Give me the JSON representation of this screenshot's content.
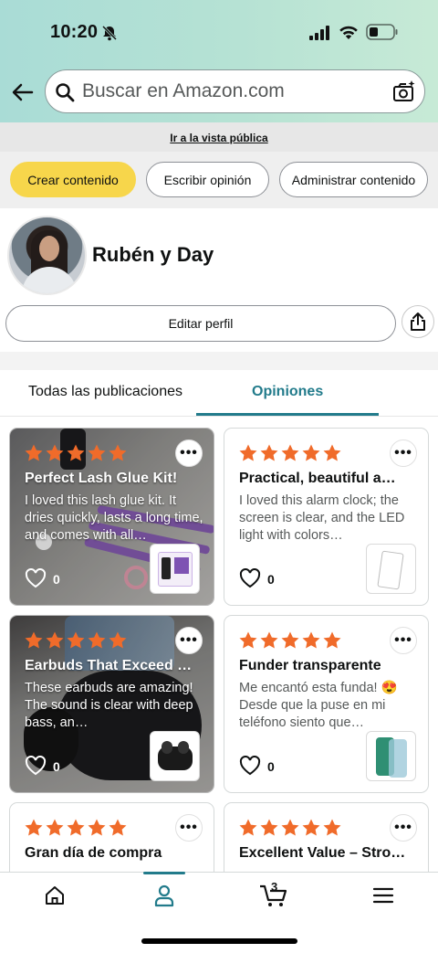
{
  "status": {
    "time": "10:20"
  },
  "search": {
    "placeholder": "Buscar en Amazon.com"
  },
  "public_link": "Ir a la vista pública",
  "actions": {
    "create": "Crear contenido",
    "write": "Escribir opinión",
    "manage": "Administrar contenido"
  },
  "profile": {
    "name": "Rubén y Day",
    "edit_label": "Editar perfil"
  },
  "tabs": {
    "all": "Todas las publicaciones",
    "reviews": "Opiniones"
  },
  "reviews": [
    {
      "title": "Perfect Lash Glue Kit!",
      "body": "I loved this lash glue kit. It dries quickly, lasts a long time, and comes with all…",
      "likes": "0",
      "rating": 5
    },
    {
      "title": "Practical, beautiful a…",
      "body": "I loved this alarm clock; the screen is clear, and the LED light with colors…",
      "likes": "0",
      "rating": 5
    },
    {
      "title": "Earbuds That Exceed …",
      "body": "These earbuds are amazing! The sound is clear with deep bass, an…",
      "likes": "0",
      "rating": 5
    },
    {
      "title": "Funder transparente",
      "body": "Me encantó esta funda! 😍 Desde que la puse en mi teléfono siento que…",
      "likes": "0",
      "rating": 5
    },
    {
      "title": "Gran día de compra",
      "rating": 5
    },
    {
      "title": "Excellent Value – Stro…",
      "rating": 5
    }
  ],
  "cart": {
    "count": "3"
  },
  "colors": {
    "accent": "#227b8b",
    "star": "#f06b2a",
    "primary_button": "#f7d64b"
  },
  "icons": [
    "bell-slash-icon",
    "signal-icon",
    "wifi-icon",
    "battery-icon",
    "back-arrow-icon",
    "search-icon",
    "camera-search-icon",
    "share-icon",
    "more-icon",
    "heart-icon",
    "home-icon",
    "user-icon",
    "cart-icon",
    "menu-icon"
  ]
}
